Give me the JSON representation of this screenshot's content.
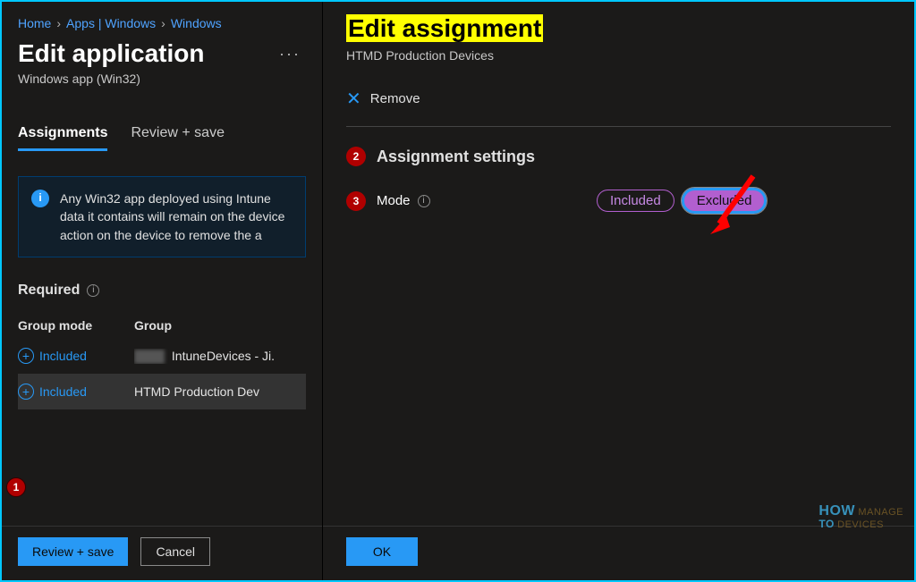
{
  "breadcrumb": {
    "home": "Home",
    "apps": "Apps | Windows",
    "windows": "Windows"
  },
  "leftPanel": {
    "title": "Edit application",
    "subtitle": "Windows app (Win32)",
    "tabs": {
      "assignments": "Assignments",
      "review": "Review + save"
    },
    "infoBox": "Any Win32 app deployed using Intune data it contains will remain on the device action on the device to remove the a",
    "requiredSection": "Required",
    "table": {
      "colMode": "Group mode",
      "colGroup": "Group",
      "rows": [
        {
          "mode": "Included",
          "group": "IntuneDevices - Ji."
        },
        {
          "mode": "Included",
          "group": "HTMD Production Dev"
        }
      ]
    },
    "footer": {
      "reviewSave": "Review + save",
      "cancel": "Cancel"
    }
  },
  "flyout": {
    "title": "Edit assignment",
    "subtitle": "HTMD Production Devices",
    "remove": "Remove",
    "settingsHeader": "Assignment settings",
    "modeLabel": "Mode",
    "toggle": {
      "included": "Included",
      "excluded": "Excluded"
    },
    "ok": "OK"
  },
  "annotations": {
    "n1": "1",
    "n2": "2",
    "n3": "3"
  },
  "watermark": {
    "l1": "HOW",
    "l2": "TO",
    "l3": "MANAGE",
    "l4": "DEVICES"
  }
}
